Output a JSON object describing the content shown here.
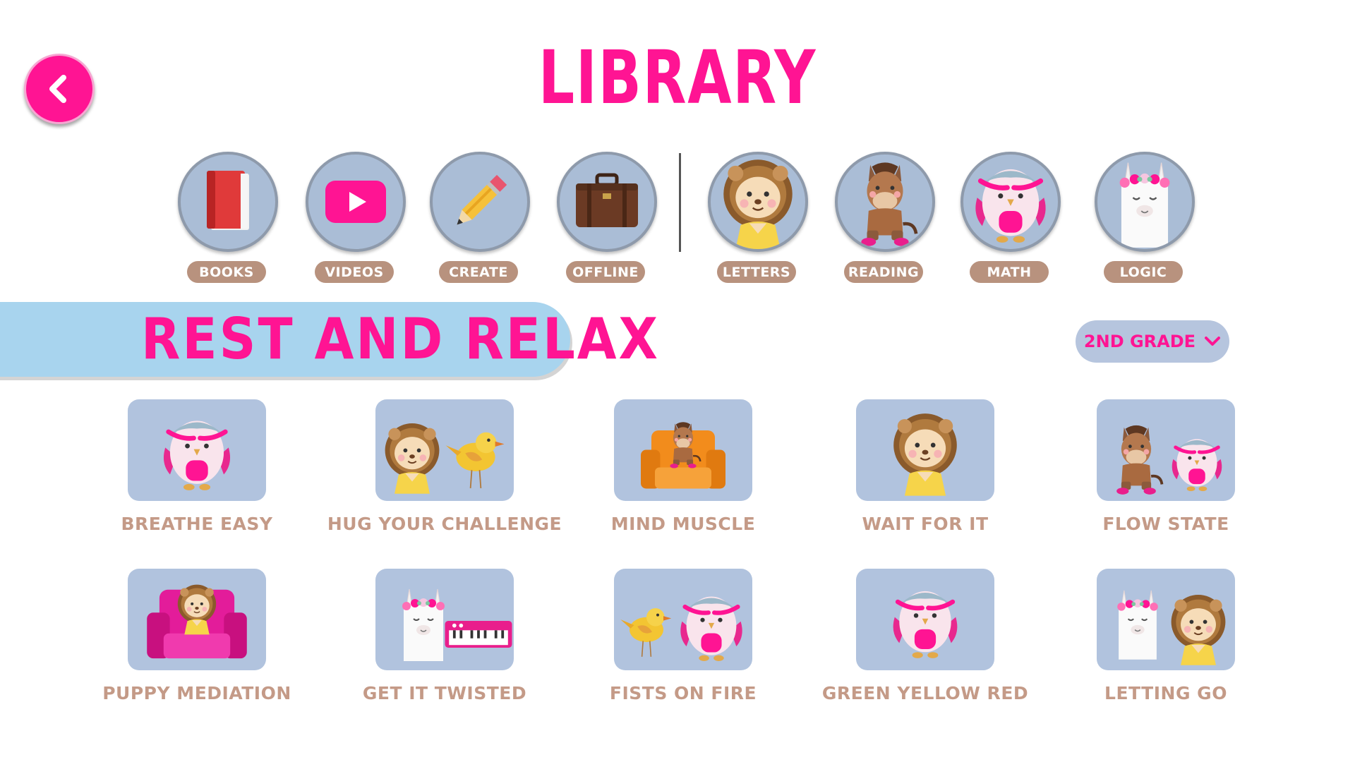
{
  "header": {
    "title": "LIBRARY"
  },
  "nav": {
    "items": [
      {
        "label": "BOOKS",
        "icon": "book-icon"
      },
      {
        "label": "VIDEOS",
        "icon": "video-play-icon"
      },
      {
        "label": "CREATE",
        "icon": "pencil-icon"
      },
      {
        "label": "OFFLINE",
        "icon": "suitcase-icon"
      },
      {
        "label": "LETTERS",
        "icon": "lion-icon"
      },
      {
        "label": "READING",
        "icon": "horse-icon"
      },
      {
        "label": "MATH",
        "icon": "owl-icon"
      },
      {
        "label": "LOGIC",
        "icon": "llama-icon"
      }
    ]
  },
  "section": {
    "title": "REST AND RELAX",
    "grade": "2ND GRADE"
  },
  "cards": [
    {
      "label": "BREATHE EASY",
      "art": "owl"
    },
    {
      "label": "HUG YOUR CHALLENGE",
      "art": "lion-bird"
    },
    {
      "label": "MIND MUSCLE",
      "art": "horse-chair"
    },
    {
      "label": "WAIT FOR IT",
      "art": "lion"
    },
    {
      "label": "FLOW STATE",
      "art": "horse-owl"
    },
    {
      "label": "PUPPY MEDIATION",
      "art": "lion-chair"
    },
    {
      "label": "GET IT TWISTED",
      "art": "llama-keyboard"
    },
    {
      "label": "FISTS ON FIRE",
      "art": "bird-owl"
    },
    {
      "label": "GREEN YELLOW RED",
      "art": "owl"
    },
    {
      "label": "LETTING GO",
      "art": "llama-lion"
    }
  ],
  "colors": {
    "accent": "#ff1493",
    "pill": "#b8927e",
    "tile": "#b1c3de",
    "banner": "#a8d4ee",
    "label": "#c49a87"
  }
}
